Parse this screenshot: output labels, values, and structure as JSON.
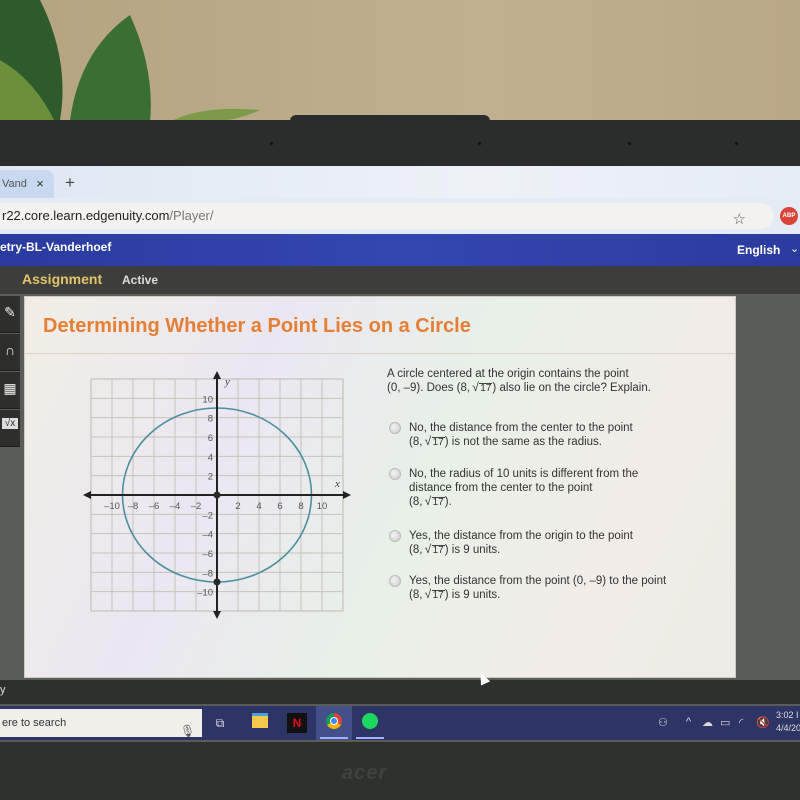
{
  "browser": {
    "tab_label": "Vand",
    "tab_close": "×",
    "new_tab": "+",
    "url_host": "r22.core.learn.edgenuity.com",
    "url_path": "/Player/",
    "bookmark_icon": "☆",
    "extension_badge": "ABP"
  },
  "course_header": {
    "title": "etry-BL-Vanderhoef",
    "language": "English",
    "language_caret": "⌄"
  },
  "subheader": {
    "section": "Assignment",
    "status": "Active"
  },
  "tools": [
    {
      "icon": "pencil-icon",
      "glyph": "✎"
    },
    {
      "icon": "headphones-icon",
      "glyph": "∩"
    },
    {
      "icon": "calculator-icon",
      "glyph": "▦"
    },
    {
      "icon": "formula-icon",
      "glyph": "√x"
    }
  ],
  "lesson": {
    "title": "Determining Whether a Point Lies on a Circle",
    "question_line1": "A circle centered at the origin contains the point",
    "question_line2_pre": "(0, –9). Does (8, ",
    "question_radicand": "17",
    "question_line2_post": ") also lie on the circle? Explain.",
    "options": [
      {
        "lines": [
          "No, the distance from the center to the point"
        ],
        "pre": "(8, ",
        "radicand": "17",
        "post": ") is not the same as the radius."
      },
      {
        "lines": [
          "No, the radius of 10 units is different from the",
          "distance from the center to the point"
        ],
        "pre": "(8, ",
        "radicand": "17",
        "post": ")."
      },
      {
        "lines": [
          "Yes, the distance from the origin to the point"
        ],
        "pre": "(8, ",
        "radicand": "17",
        "post": ") is 9 units."
      },
      {
        "lines": [
          "Yes, the distance from the point  (0, –9) to the point"
        ],
        "pre": "(8, ",
        "radicand": "17",
        "post": ") is 9 units."
      }
    ]
  },
  "chart_data": {
    "type": "scatter",
    "title": "",
    "xlabel": "x",
    "ylabel": "y",
    "xlim": [
      -12,
      12
    ],
    "ylim": [
      -12,
      12
    ],
    "grid": true,
    "x_ticks": [
      -10,
      -8,
      -6,
      -4,
      -2,
      2,
      4,
      6,
      8,
      10
    ],
    "y_ticks": [
      10,
      8,
      6,
      4,
      2,
      -2,
      -4,
      -6,
      -8,
      -10
    ],
    "x_tick_labels": [
      "–10",
      "–8",
      "–6",
      "–4",
      "–2",
      "2",
      "4",
      "6",
      "8",
      "10"
    ],
    "y_tick_labels": [
      "10",
      "8",
      "6",
      "4",
      "2",
      "–2",
      "–4",
      "–6",
      "–8",
      "–10"
    ],
    "circle": {
      "center": [
        0,
        0
      ],
      "radius": 9,
      "color": "#4b8fa0"
    },
    "points": [
      {
        "label": "origin",
        "x": 0,
        "y": 0
      },
      {
        "label": "(0, -9)",
        "x": 0,
        "y": -9
      }
    ]
  },
  "desktop": {
    "label": "y"
  },
  "taskbar": {
    "search_placeholder": "ere to search",
    "apps": [
      "task-view",
      "file-explorer",
      "netflix",
      "chrome",
      "spotify"
    ],
    "time": "3:02 I",
    "date": "4/4/20"
  }
}
